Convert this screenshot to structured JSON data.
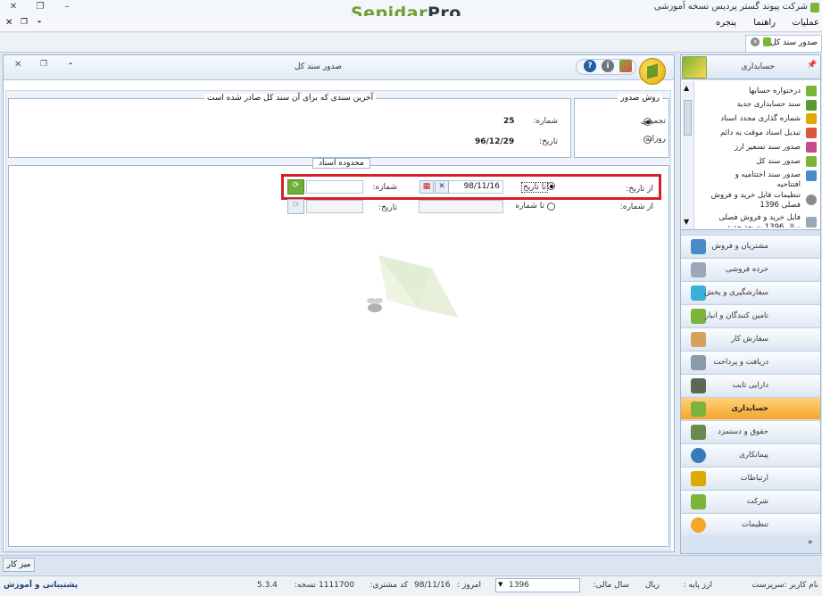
{
  "window": {
    "app_title": "شرکت پیوند گستر پردیس نسخه آموزشی",
    "brand_part1": "Sepidar",
    "brand_part2": "Pro"
  },
  "menu": {
    "items": [
      "عملیات",
      "راهنما",
      "پنجره"
    ]
  },
  "doc_tab": {
    "label": "صدور سند کل"
  },
  "form": {
    "title": "صدور سند کل",
    "issue_method": {
      "title": "روش صدور",
      "options": [
        "تجمیعی",
        "روزانه"
      ],
      "selected": "تجمیعی"
    },
    "last_doc": {
      "title": "آخرین سندی که برای آن سند کل صادر شده است",
      "number_label": "شماره:",
      "number_value": "25",
      "date_label": "تاریخ:",
      "date_value": "96/12/29"
    },
    "range": {
      "title": "محدوده اسناد",
      "from_date_label": "از تاریخ:",
      "to_date_label": "تا تاریخ",
      "to_date_value": "98/11/16",
      "number_label": "شماره:",
      "from_number_label": "از شماره:",
      "to_number_label": "تا شماره",
      "date_label": "تاریخ:"
    }
  },
  "sidebar": {
    "header": "حسابداری",
    "items": [
      "درختواره حسابها",
      "سند حسابداری جدید",
      "شماره گذاری مجدد اسناد",
      "تبدیل اسناد موقت به دائم",
      "صدور سند تسعیر ارز",
      "صدور سند کل",
      "صدور سند اختتامیه و",
      "افتتاحیه",
      "تنظیمات فایل خرید و فروش",
      "فصلی 1396",
      "فایل خرید و فروش فصلی",
      "سال 1396 به بعد جدید"
    ],
    "categories": [
      "مشتریان و فروش",
      "خرده فروشی",
      "سفارشگیری و پخش",
      "تامین کنندگان و انبار",
      "سفارش کار",
      "دریافت و پرداخت",
      "دارایی ثابت",
      "حسابداری",
      "حقوق و دستمزد",
      "پیمانکاری",
      "ارتباطات",
      "شرکت",
      "تنظیمات"
    ],
    "active_category": "حسابداری",
    "colors": {
      "active": "#f4a52a"
    }
  },
  "taskbar": {
    "desk_button": "میز کار"
  },
  "status": {
    "user": "نام کاربر :سرپرست",
    "base_currency_label": "ارز پایه :",
    "base_currency": "ریال",
    "fiscal_year_label": "سال مالی:",
    "fiscal_year": "1396",
    "today_label": "امروز :",
    "today": "98/11/16",
    "customer_code_label": "کد مشتری:",
    "customer_code": "1111700",
    "version_label": "نسخه:",
    "version": "5.3.4",
    "support": "پشتیبانی و آموزش"
  }
}
